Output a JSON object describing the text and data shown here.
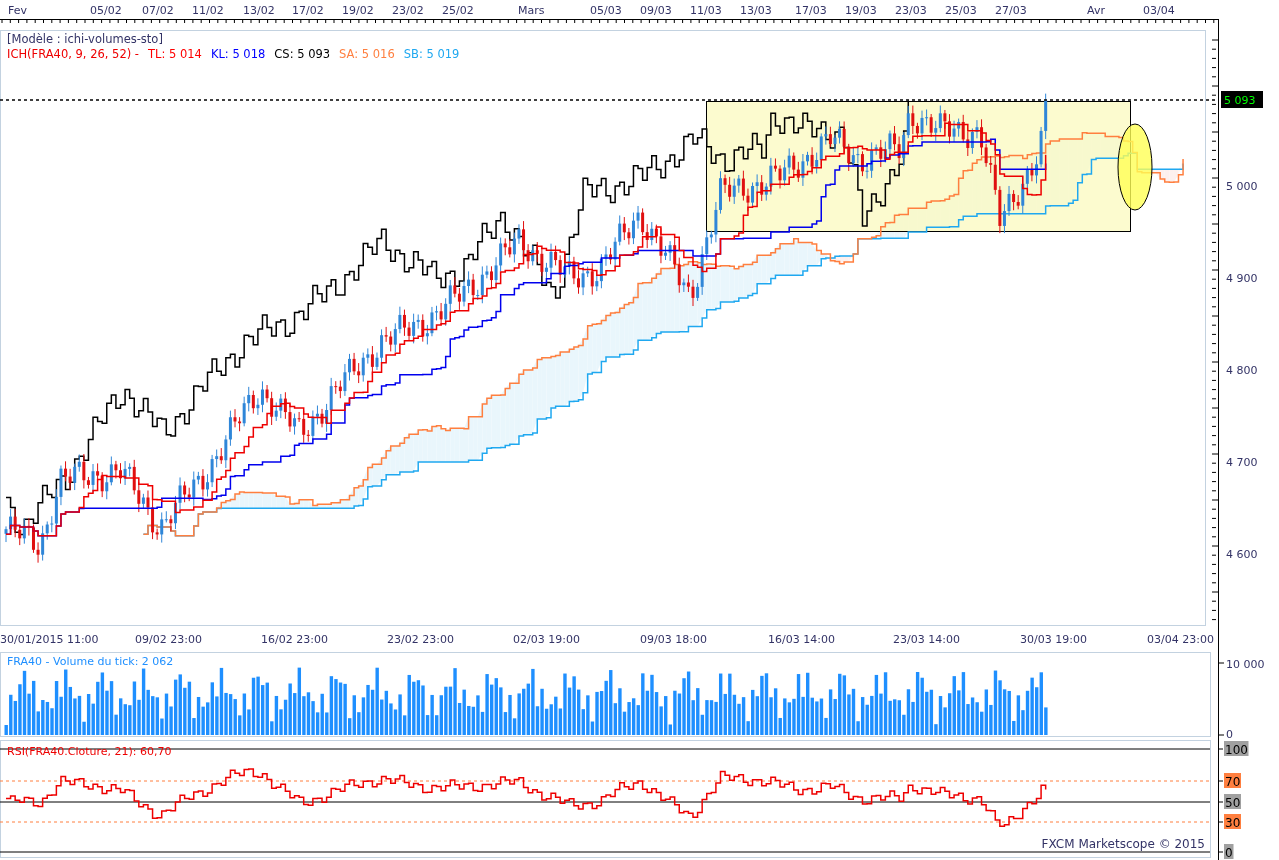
{
  "top_axis": {
    "labels": [
      "Fev",
      "05/02",
      "07/02",
      "11/02",
      "13/02",
      "17/02",
      "19/02",
      "23/02",
      "25/02",
      "Mars",
      "05/03",
      "09/03",
      "11/03",
      "13/03",
      "17/03",
      "19/03",
      "23/03",
      "25/03",
      "27/03",
      "Avr",
      "03/04"
    ]
  },
  "price_panel": {
    "template_label": "[Modèle : ichi-volumes-sto]",
    "indicator": {
      "name": "ICH(FRA40, 9, 26, 52) -",
      "values": [
        {
          "label": "TL: 5 014",
          "color": "#ff0000"
        },
        {
          "label": "KL: 5 018",
          "color": "#0000ff"
        },
        {
          "label": "CS: 5 093",
          "color": "#000000"
        },
        {
          "label": "SA: 5 016",
          "color": "#ff7f3f"
        },
        {
          "label": "SB: 5 019",
          "color": "#1fa8f0"
        }
      ]
    },
    "price_axis": [
      "5 000",
      "4 900",
      "4 800",
      "4 700",
      "4 600"
    ],
    "last_price": "5 093",
    "time_axis": [
      "30/01/2015 11:00",
      "09/02 23:00",
      "16/02 23:00",
      "23/02 23:00",
      "02/03 19:00",
      "09/03 18:00",
      "16/03 14:00",
      "23/03 14:00",
      "30/03 19:00",
      "03/04 23:00"
    ]
  },
  "volume_panel": {
    "title": "FRA40 - Volume du tick: 2 062",
    "axis": [
      "10 000",
      "0"
    ]
  },
  "rsi_panel": {
    "title": "RSI(FRA40.Cloture, 21): 60,70",
    "axis": [
      {
        "label": "100",
        "kind": "bound"
      },
      {
        "label": "70",
        "kind": "level"
      },
      {
        "label": "50",
        "kind": "bound"
      },
      {
        "label": "30",
        "kind": "level"
      },
      {
        "label": "0",
        "kind": "bound"
      }
    ]
  },
  "footer": "FXCM Marketscope © 2015"
}
